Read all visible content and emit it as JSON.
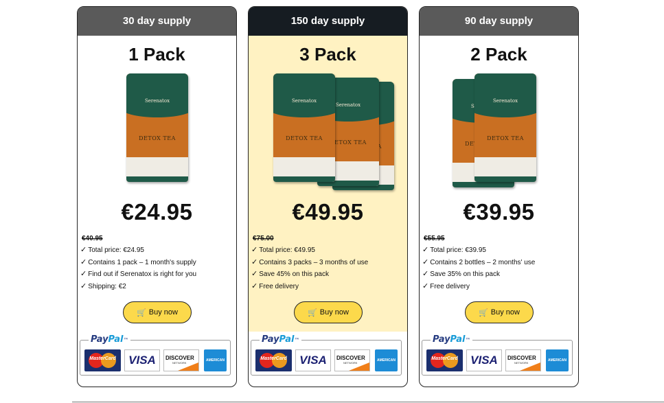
{
  "cards": [
    {
      "header": "30 day supply",
      "title": "1 Pack",
      "pouch_count": 1,
      "price": "€24.95",
      "old_price": "€40.95",
      "features": [
        "Total price: €24.95",
        "Contains 1 pack – 1 month's supply",
        "Find out if Serenatox is right for you",
        "Shipping: €2"
      ],
      "buy_label": "Buy now"
    },
    {
      "header": "150 day supply",
      "title": "3 Pack",
      "pouch_count": 3,
      "price": "€49.95",
      "old_price": "€75.00",
      "features": [
        "Total price: €49.95",
        "Contains 3 packs – 3 months of use",
        "Save 45% on this pack",
        "Free delivery"
      ],
      "buy_label": "Buy now",
      "highlighted": true
    },
    {
      "header": "90 day supply",
      "title": "2 Pack",
      "pouch_count": 2,
      "price": "€39.95",
      "old_price": "€55.95",
      "features": [
        "Total price: €39.95",
        "Contains 2 bottles – 2 months' use",
        "Save 35% on this pack",
        "Free delivery"
      ],
      "buy_label": "Buy now"
    }
  ],
  "product": {
    "brand": "Serenatox",
    "name": "DETOX TEA"
  },
  "payment": {
    "paypal_pay": "Pay",
    "paypal_pal": "Pal",
    "mastercard": "MasterCard",
    "visa": "VISA",
    "discover": "DISCOVER",
    "discover_sub": "NETWORK",
    "amex": "AMERICAN EXPRESS"
  },
  "colors": {
    "header_gray": "#5a5a5a",
    "header_dark": "#161c22",
    "highlight_bg": "#fff2c2",
    "button_yellow": "#fcd94b",
    "pouch_green": "#1f5a48",
    "pouch_orange": "#c96f22"
  },
  "icons": {
    "check": "check-icon",
    "cart": "cart-icon"
  }
}
